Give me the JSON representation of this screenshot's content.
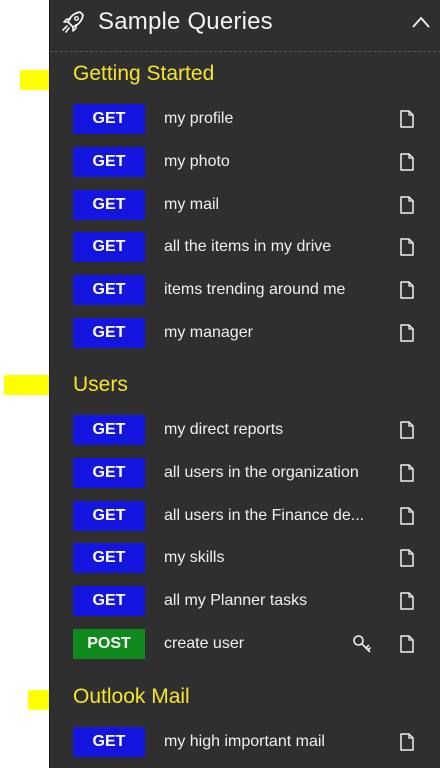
{
  "header": {
    "title": "Sample Queries",
    "rocket_icon": "rocket-icon",
    "collapse_icon": "chevron-up-icon"
  },
  "colors": {
    "panel_bg": "#2f2f2f",
    "section_heading": "#f5e52a",
    "highlight": "#ffff00",
    "get_badge": "#1515e0",
    "post_badge": "#118a1d",
    "text": "#f0f0f0"
  },
  "sections": [
    {
      "heading": "Getting Started",
      "queries": [
        {
          "method": "GET",
          "label": "my profile"
        },
        {
          "method": "GET",
          "label": "my photo"
        },
        {
          "method": "GET",
          "label": "my mail"
        },
        {
          "method": "GET",
          "label": "all the items in my drive"
        },
        {
          "method": "GET",
          "label": "items trending around me"
        },
        {
          "method": "GET",
          "label": "my manager"
        }
      ]
    },
    {
      "heading": "Users",
      "queries": [
        {
          "method": "GET",
          "label": "my direct reports"
        },
        {
          "method": "GET",
          "label": "all users in the organization"
        },
        {
          "method": "GET",
          "label": "all users in the Finance de..."
        },
        {
          "method": "GET",
          "label": "my skills"
        },
        {
          "method": "GET",
          "label": "all my Planner tasks"
        },
        {
          "method": "POST",
          "label": "create user",
          "extra_icon": "key-icon"
        }
      ]
    },
    {
      "heading": "Outlook Mail",
      "queries": [
        {
          "method": "GET",
          "label": "my high important mail"
        }
      ]
    }
  ],
  "row_icon": "document-icon"
}
